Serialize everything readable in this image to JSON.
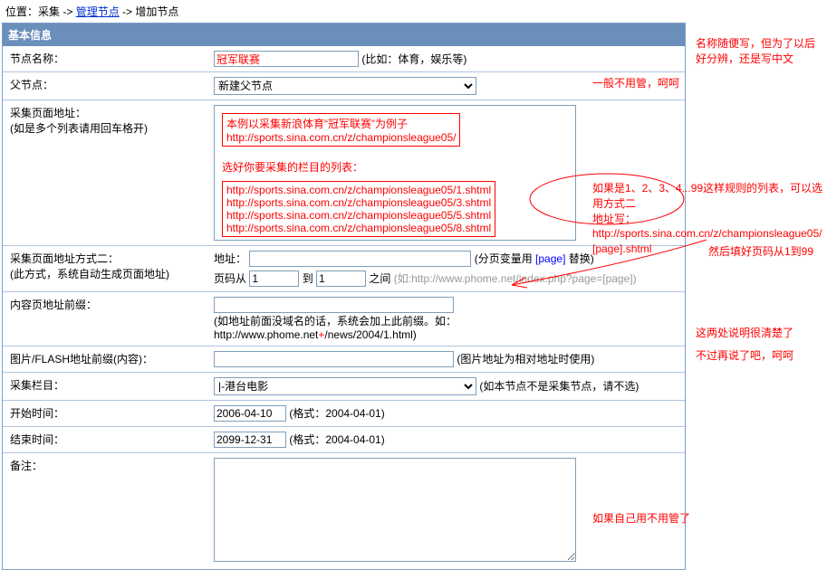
{
  "breadcrumb": {
    "prefix": "位置：采集 -> ",
    "link": "管理节点",
    "suffix": " -> 增加节点"
  },
  "header": {
    "title": "基本信息"
  },
  "rows": {
    "name": {
      "label": "节点名称：",
      "value": "冠军联赛",
      "hint": "(比如：体育，娱乐等)"
    },
    "parent": {
      "label": "父节点：",
      "option": "新建父节点"
    },
    "pageUrl": {
      "label1": "采集页面地址：",
      "label2": "(如是多个列表请用回车格开)",
      "box1_l1": "本例以采集新浪体育“冠军联赛”为例子",
      "box1_l2": "http://sports.sina.com.cn/z/championsleague05/",
      "prompt": "选好你要采集的栏目的列表：",
      "url1": "http://sports.sina.com.cn/z/championsleague05/1.shtml",
      "url2": "http://sports.sina.com.cn/z/championsleague05/3.shtml",
      "url3": "http://sports.sina.com.cn/z/championsleague05/5.shtml",
      "url4": "http://sports.sina.com.cn/z/championsleague05/8.shtml"
    },
    "method2": {
      "label1": "采集页面地址方式二：",
      "label2": "(此方式，系统自动生成页面地址)",
      "addrLabel": "地址：",
      "pageVarHint1": "(分页变量用 ",
      "pageVarHint2": "[page]",
      "pageVarHint3": " 替换)",
      "pageFromLabel": "页码从",
      "pageFromValue": "1",
      "pageToLabel": "到",
      "pageToValue": "1",
      "pageBetween": "之间",
      "example": "(如:http://www.phome.net/index.php?page=[page])"
    },
    "contentPrefix": {
      "label": "内容页地址前缀：",
      "hint1": "(如地址前面没域名的话，系统会加上此前缀。如：",
      "hint2a": "http://www.phome.net",
      "hint2b": "+",
      "hint2c": "/news/2004/1.html)"
    },
    "flashPrefix": {
      "label": "图片/FLASH地址前缀(内容)：",
      "hint": "(图片地址为相对地址时使用)"
    },
    "column": {
      "label": "采集栏目：",
      "option": "|-港台电影",
      "hint": "(如本节点不是采集节点，请不选)"
    },
    "startTime": {
      "label": "开始时间：",
      "value": "2006-04-10",
      "hint": "(格式：2004-04-01)"
    },
    "endTime": {
      "label": "结束时间：",
      "value": "2099-12-31",
      "hint": "(格式：2004-04-01)"
    },
    "remark": {
      "label": "备注："
    }
  },
  "annotations": {
    "a1": "名称随便写，但为了以后好分辨，还是写中文",
    "a2": "一般不用管，呵呵",
    "a3_l1": "如果是1、2、3、4...99这样规则的列表，可以选用方式二",
    "a3_l2": "地址写：",
    "a3_l3": "http://sports.sina.com.cn/z/championsleague05/[page].shtml",
    "a3_l4": "然后填好页码从1到99",
    "a4_l1": "这两处说明很清楚了",
    "a4_l2": "不过再说了吧，呵呵",
    "a5": "如果自己用不用管了"
  }
}
